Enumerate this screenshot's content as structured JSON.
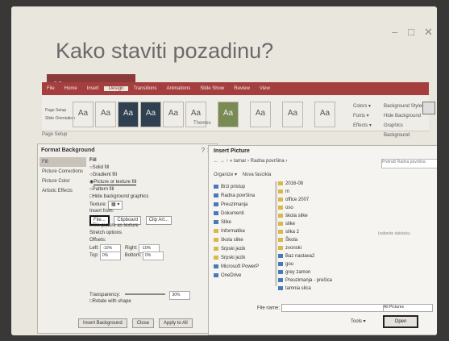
{
  "slide": {
    "title": "Kako staviti pozadinu?",
    "window_controls": [
      "–",
      "□",
      "✕"
    ]
  },
  "ribbon": {
    "quick_access": "▪ ↶ ↷ ▾",
    "tabs": [
      "File",
      "Home",
      "Insert",
      "Design",
      "Transitions",
      "Animations",
      "Slide Show",
      "Review",
      "View"
    ],
    "theme_tiles": [
      "Aa",
      "Aa",
      "Aa",
      "Aa",
      "Aa",
      "Aa",
      "Aa",
      "Aa",
      "Aa",
      "Aa"
    ],
    "right_group": [
      "Colors ▾",
      "Fonts ▾",
      "Effects ▾"
    ],
    "background_group": [
      "Background Styles ▾",
      "Hide Background Graphics",
      "Background"
    ],
    "themes_label": "Themes",
    "left_buttons": [
      "Page Setup",
      "Slide Orientation"
    ],
    "top_split": "Page Setup"
  },
  "format_background": {
    "title": "Format Background",
    "close": "?   ✕",
    "nav": [
      "Fill",
      "Picture Corrections",
      "Picture Color",
      "Artistic Effects"
    ],
    "fill_header": "Fill",
    "options": [
      "Solid fill",
      "Gradient fill",
      "Picture or texture fill",
      "Pattern fill",
      "Hide background graphics"
    ],
    "texture_label": "Texture:",
    "insert_from": "Insert from:",
    "file_btn": "File...",
    "clipboard_btn": "Clipboard",
    "clipart_btn": "Clip Art...",
    "tile_label": "Tile picture as texture",
    "stretch_label": "Stretch options",
    "offsets_label": "Offsets:",
    "offsets": [
      {
        "label": "Left:",
        "value": "-10%"
      },
      {
        "label": "Right:",
        "value": "-10%"
      },
      {
        "label": "Top:",
        "value": "0%"
      },
      {
        "label": "Bottom:",
        "value": "0%"
      }
    ],
    "transparency_label": "Transparency:",
    "transparency_value": "30%",
    "rotate_label": "Rotate with shape",
    "footer": [
      "Insert Background",
      "Close",
      "Apply to All"
    ]
  },
  "insert_picture": {
    "title": "Insert Picture",
    "address": "← → ↑  « tamar › Radna površina ›",
    "search_placeholder": "Pretraži Radna površina",
    "organize": "Organize ▾",
    "new_folder": "Nova fascikla",
    "nav_items": [
      "Brzi pristup",
      "Radna površina",
      "Preuzimanja",
      "Dokumenti",
      "Slike",
      "Informatika",
      "škola slike",
      "Srpski jezik",
      "Srpski jezik",
      "Microsoft PowerP",
      "OneDrive"
    ],
    "files": [
      "2016-08",
      "m",
      "office 2007",
      "oso",
      "škola slike",
      "slike",
      "slika 2",
      "Škola",
      "zvonski",
      "Baz nastava2",
      "gou",
      "grey zamon",
      "Preuzimanja - prečica",
      "tamnia slica"
    ],
    "selection_hint": "Izaberite datoteku",
    "file_name_label": "File name:",
    "file_type": "All Pictures",
    "tools": "Tools ▾",
    "open": "Open"
  }
}
